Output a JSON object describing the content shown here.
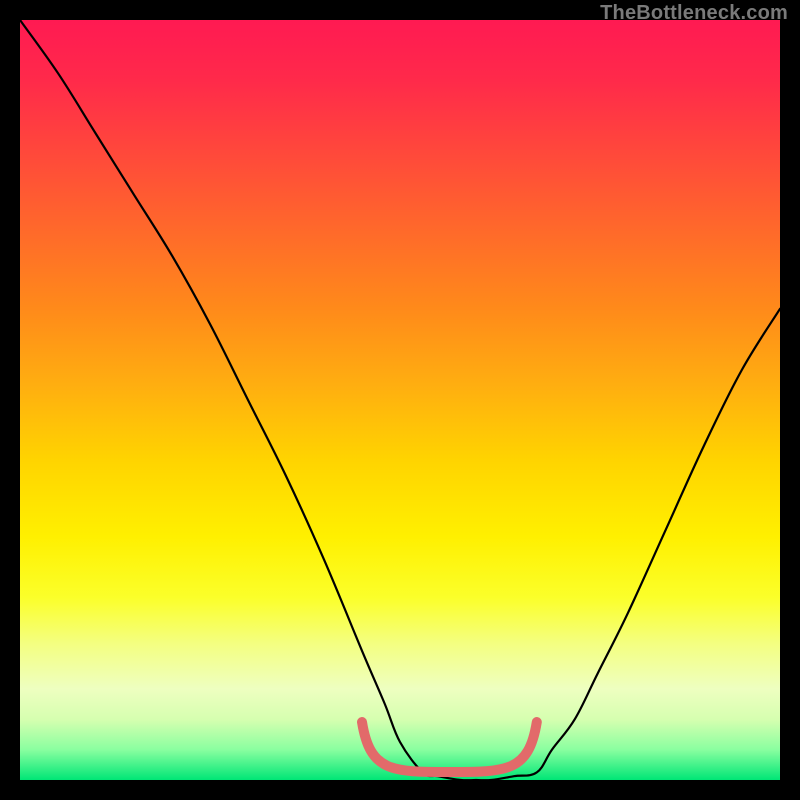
{
  "watermark": "TheBottleneck.com",
  "colors": {
    "curve": "#000000",
    "accent": "#e26a6a",
    "gradient_top": "#ff1a52",
    "gradient_bottom": "#00e676",
    "frame": "#000000"
  },
  "chart_data": {
    "type": "line",
    "title": "",
    "xlabel": "",
    "ylabel": "",
    "xlim": [
      0,
      100
    ],
    "ylim": [
      0,
      100
    ],
    "series": [
      {
        "name": "bottleneck-curve",
        "x": [
          0,
          5,
          10,
          15,
          20,
          25,
          30,
          35,
          40,
          45,
          48,
          50,
          53,
          55,
          58,
          60,
          62,
          65,
          68,
          70,
          73,
          76,
          80,
          85,
          90,
          95,
          100
        ],
        "values": [
          100,
          93,
          85,
          77,
          69,
          60,
          50,
          40,
          29,
          17,
          10,
          5,
          1,
          0.5,
          0,
          0,
          0,
          0.5,
          1,
          4,
          8,
          14,
          22,
          33,
          44,
          54,
          62
        ]
      }
    ],
    "annotations": [
      {
        "name": "bottom-accent-segment",
        "x_start": 45,
        "x_end": 68,
        "y": 0
      }
    ]
  }
}
